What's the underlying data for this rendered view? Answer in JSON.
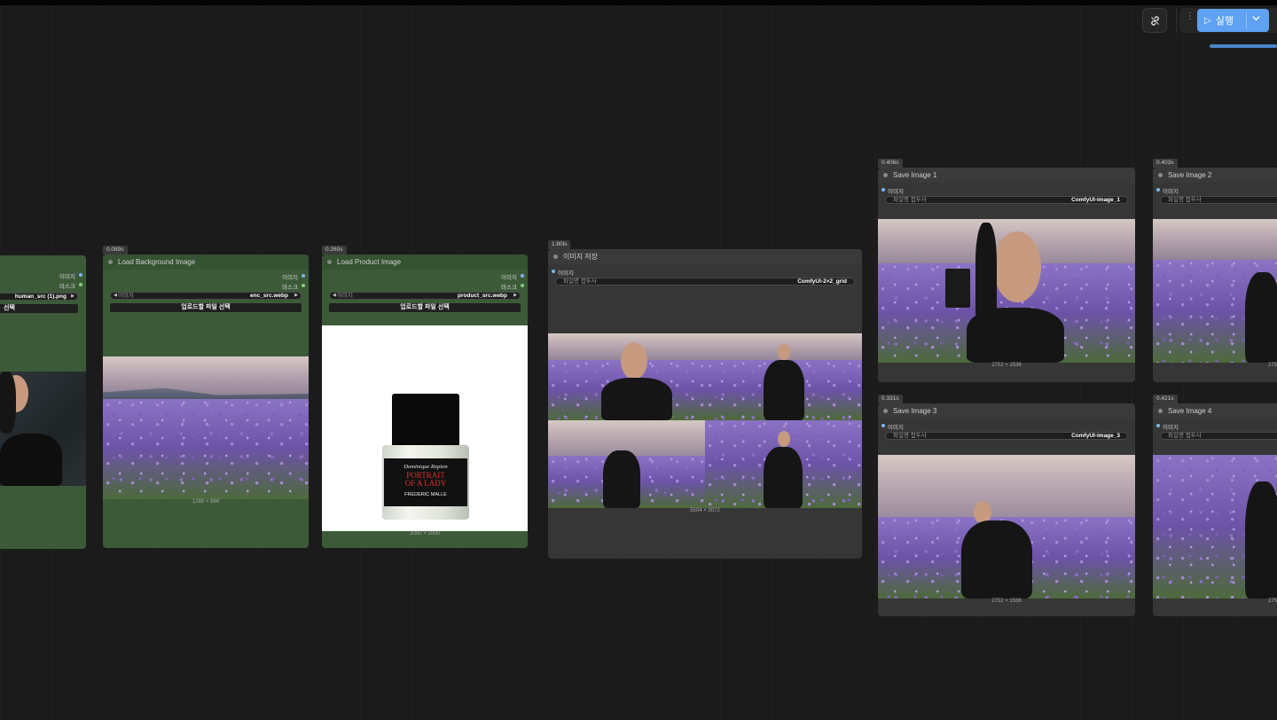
{
  "toolbar": {
    "run_label": "실행",
    "link_icon": "link-icon",
    "play_icon": "play-icon",
    "chevron_icon": "chevron-down-icon"
  },
  "nodes": {
    "human": {
      "outputs": [
        "이미지",
        "마스크"
      ],
      "file_value": "human_src (1).png",
      "upload_label": "선택"
    },
    "background": {
      "timing": "0.089s",
      "title": "Load Background Image",
      "outputs": [
        "이미지",
        "마스크"
      ],
      "file_label": "이미지",
      "file_value": "enc_src.webp",
      "upload_label": "업로드할 파일 선택",
      "caption": "1280 × 694"
    },
    "product": {
      "timing": "0.260s",
      "title": "Load Product Image",
      "outputs": [
        "이미지",
        "마스크"
      ],
      "file_label": "이미지",
      "file_value": "product_src.webp",
      "upload_label": "업로드할 파일 선택",
      "caption": "2000 × 2000",
      "bottle": {
        "brand": "Dominique Ropion",
        "name1": "PORTRAIT",
        "name2": "OF A LADY",
        "house": "FREDERIC MALLE"
      }
    },
    "grid": {
      "timing": "1.80ls",
      "title": "이미지 저장",
      "input": "이미지",
      "prefix_label": "파일명 접두사",
      "prefix_value": "ComfyUI-2×2_grid",
      "caption": "5504 × 3072"
    },
    "save1": {
      "timing": "0.406s",
      "title": "Save Image 1",
      "input": "이미지",
      "prefix_label": "파일명 접두사",
      "prefix_value": "ComfyUI-image_1",
      "caption": "2752 × 1536"
    },
    "save2": {
      "timing": "0.403s",
      "title": "Save Image 2",
      "input": "이미지",
      "prefix_label": "파일명 접두사",
      "caption": "275"
    },
    "save3": {
      "timing": "0.331s",
      "title": "Save Image 3",
      "input": "이미지",
      "prefix_label": "파일명 접두사",
      "prefix_value": "ComfyUI-image_3",
      "caption": "2752 × 1536"
    },
    "save4": {
      "timing": "0.421s",
      "title": "Save Image 4",
      "input": "이미지",
      "prefix_label": "파일명 접두사",
      "caption": "275"
    }
  },
  "colors": {
    "canvas": "#1b1b1b",
    "load_node": "#3c5a38",
    "save_node": "#363636",
    "run_button": "#5fa1f2",
    "image_dot": "#7db4f0",
    "mask_dot": "#7dd37a"
  }
}
